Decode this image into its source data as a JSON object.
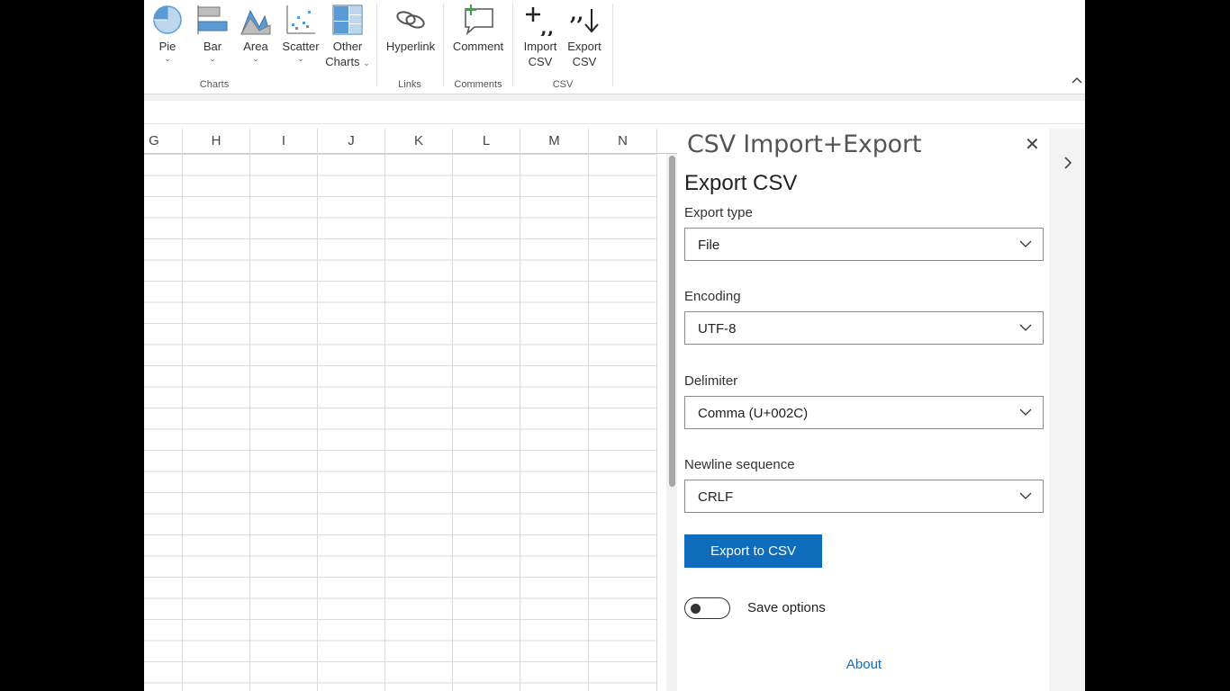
{
  "ribbon": {
    "charts_group": {
      "label": "Charts",
      "pie": "Pie",
      "bar": "Bar",
      "area": "Area",
      "scatter": "Scatter",
      "other_charts_line1": "Other",
      "other_charts_line2": "Charts"
    },
    "links_group": {
      "label": "Links",
      "hyperlink": "Hyperlink"
    },
    "comments_group": {
      "label": "Comments",
      "comment": "Comment"
    },
    "csv_group": {
      "label": "CSV",
      "import_line1": "Import",
      "import_line2": "CSV",
      "export_line1": "Export",
      "export_line2": "CSV"
    },
    "dropdown_caret": "⌄"
  },
  "grid": {
    "columns": [
      "G",
      "H",
      "I",
      "J",
      "K",
      "L",
      "M",
      "N"
    ]
  },
  "pane": {
    "title": "CSV Import+Export",
    "close_symbol": "✕",
    "section_title": "Export CSV",
    "export_type": {
      "label": "Export type",
      "value": "File"
    },
    "encoding": {
      "label": "Encoding",
      "value": "UTF-8"
    },
    "delimiter": {
      "label": "Delimiter",
      "value": "Comma (U+002C)"
    },
    "newline": {
      "label": "Newline sequence",
      "value": "CRLF"
    },
    "export_button": "Export to CSV",
    "save_options": {
      "label": "Save options",
      "on": false
    },
    "about_link": "About"
  },
  "colors": {
    "accent": "#0f6cbd",
    "chart_icon_blue": "#5b9bd5"
  }
}
